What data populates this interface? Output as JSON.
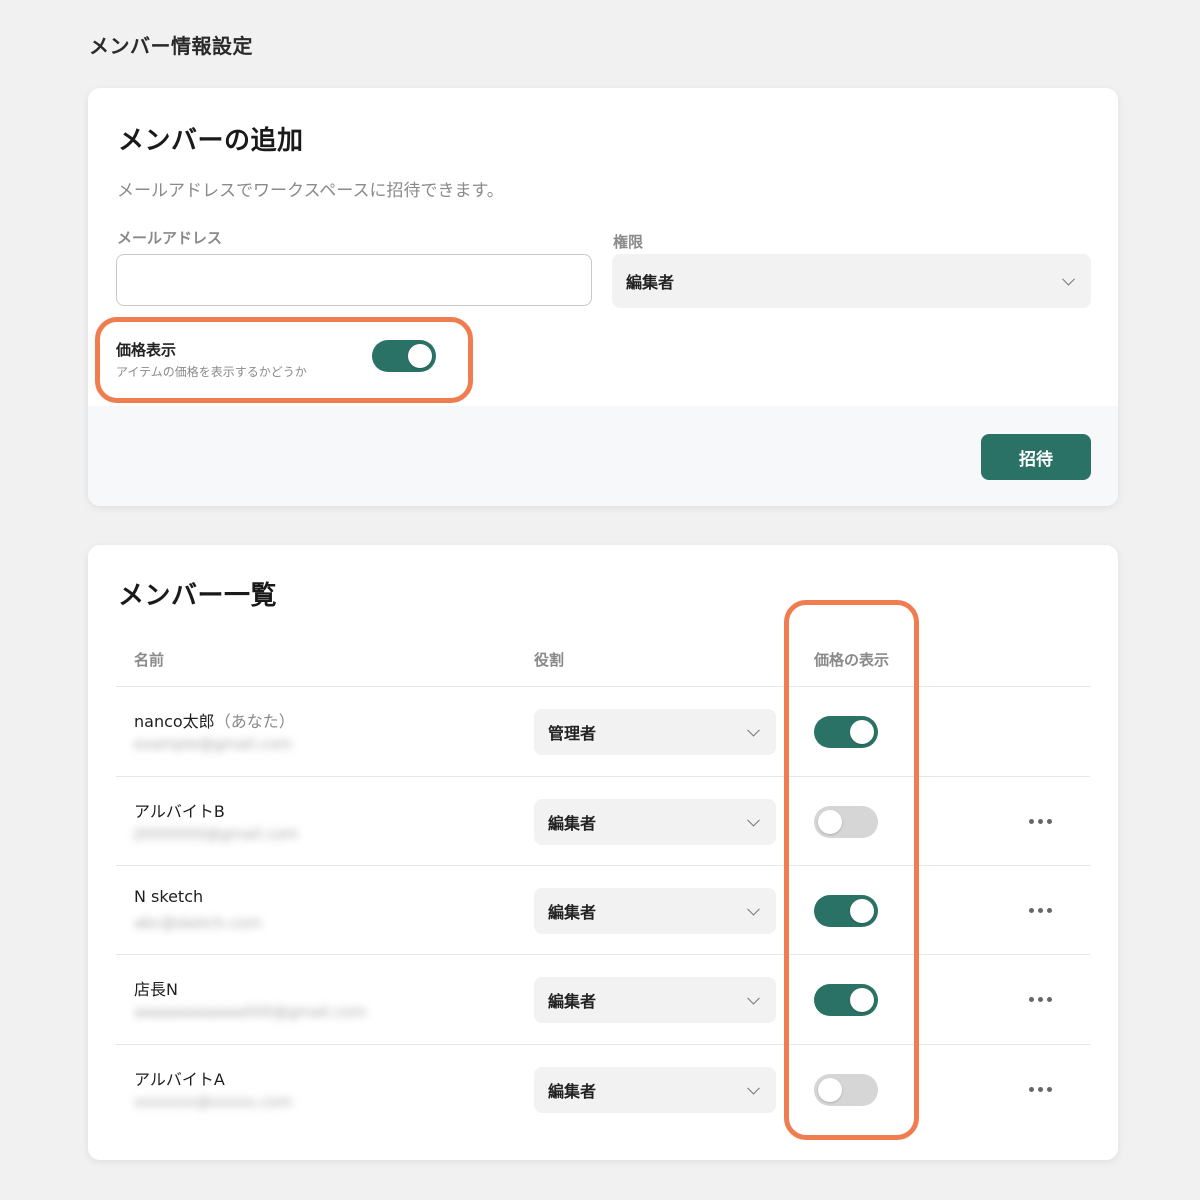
{
  "page_title": "メンバー情報設定",
  "add_card": {
    "title": "メンバーの追加",
    "description": "メールアドレスでワークスペースに招待できます。",
    "email_label": "メールアドレス",
    "email_value": "",
    "email_placeholder": "",
    "role_label": "権限",
    "role_value": "編集者",
    "price_toggle": {
      "title": "価格表示",
      "subtitle": "アイテムの価格を表示するかどうか",
      "on": true
    },
    "invite_label": "招待"
  },
  "list_card": {
    "title": "メンバー一覧",
    "columns": {
      "name": "名前",
      "role": "役割",
      "price": "価格の表示"
    },
    "members": [
      {
        "name": "nanco太郎",
        "you_suffix": "（あなた）",
        "email": "example@gmail.com",
        "role": "管理者",
        "price_on": true,
        "has_menu": false
      },
      {
        "name": "アルバイトB",
        "you_suffix": "",
        "email": "j0000000@gmail.com",
        "role": "編集者",
        "price_on": false,
        "has_menu": true
      },
      {
        "name": "N sketch",
        "you_suffix": "",
        "email": "abc@sketch.com",
        "role": "編集者",
        "price_on": true,
        "has_menu": true
      },
      {
        "name": "店長N",
        "you_suffix": "",
        "email": "aaaaaaaaaaaa000@gmail.com",
        "role": "編集者",
        "price_on": true,
        "has_menu": true
      },
      {
        "name": "アルバイトA",
        "you_suffix": "",
        "email": "xxxxxxx@xxxxx.com",
        "role": "編集者",
        "price_on": false,
        "has_menu": true
      }
    ]
  },
  "colors": {
    "accent": "#2b7266",
    "highlight": "#ef7d50",
    "toggle_off": "#d6d6d6",
    "background": "#f1f1f1"
  }
}
